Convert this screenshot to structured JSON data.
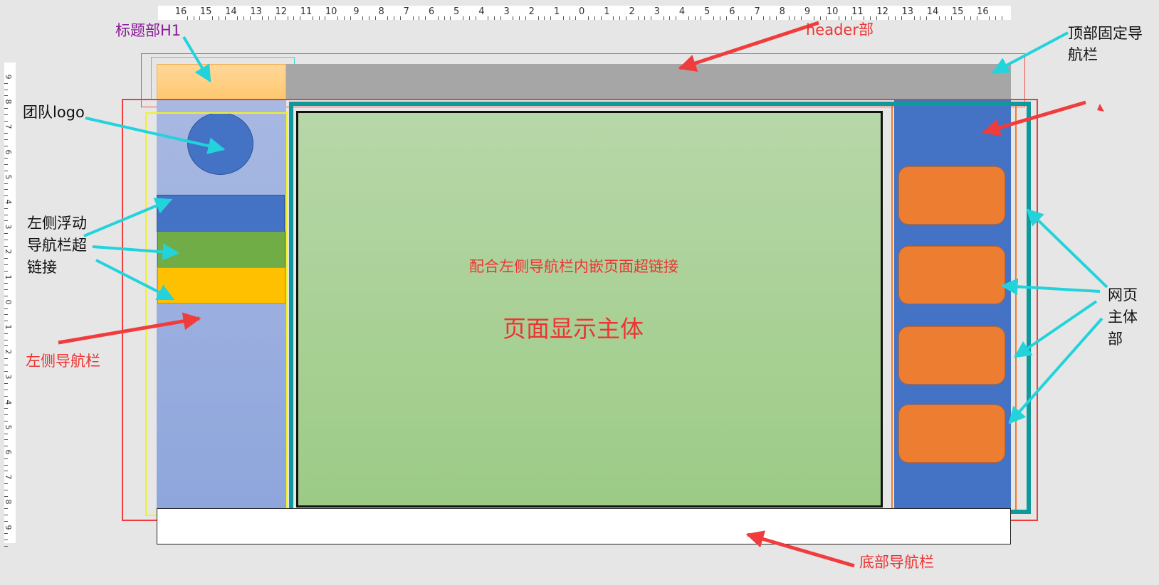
{
  "labels": {
    "h1_section": "标题部H1",
    "header": "header部",
    "top_nav": [
      "顶部固定导",
      "航栏"
    ],
    "team_logo": "团队logo",
    "left_float_nav": [
      "左侧浮动",
      "导航栏超",
      "链接"
    ],
    "left_nav": "左侧导航栏",
    "inline_link_note": "配合左侧导航栏内嵌页面超链接",
    "main_display": "页面显示主体",
    "page_body": [
      "网页",
      "主体",
      "部"
    ],
    "bottom_nav": "底部导航栏"
  },
  "ruler": {
    "top_ticks": [
      "16",
      "15",
      "14",
      "13",
      "12",
      "11",
      "10",
      "9",
      "8",
      "7",
      "6",
      "5",
      "4",
      "3",
      "2",
      "1",
      "0",
      "1",
      "2",
      "3",
      "4",
      "5",
      "6",
      "7",
      "8",
      "9",
      "10",
      "11",
      "12",
      "13",
      "14",
      "15",
      "16"
    ],
    "left_ticks": [
      "9",
      "8",
      "7",
      "6",
      "5",
      "4",
      "3",
      "2",
      "1",
      "0",
      "1",
      "2",
      "3",
      "4",
      "5",
      "6",
      "7",
      "8",
      "9"
    ]
  },
  "colors": {
    "red_label": "#ee3333",
    "purple_label": "#8a1a9a",
    "cyan_arrow": "#22d3dc",
    "red_arrow": "#f03c3c",
    "header_gray": "#a6a6a6",
    "h1_orange": "#ffd38a",
    "sidebar_blue": "#9aacdc",
    "logo_blue": "#4472c4",
    "nav_green": "#70ad47",
    "nav_yellow": "#ffc000",
    "main_green": "#a9d18e",
    "right_blue": "#4472c4",
    "button_orange": "#ed7d31",
    "teal_border": "#10999a"
  }
}
